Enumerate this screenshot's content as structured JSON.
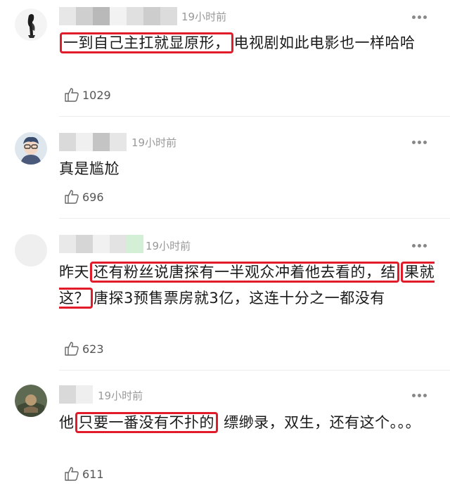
{
  "comments": [
    {
      "time": "19小时前",
      "text_pre": "",
      "highlight1": "一到自己主扛就显原形，",
      "text_mid": "电视剧如此电影也一样哈哈",
      "likes": "1029"
    },
    {
      "time": "19小时前",
      "text": "真是尴尬",
      "likes": "696"
    },
    {
      "time": "19小时前",
      "text_pre": "昨天",
      "highlight1": "还有粉丝说唐探有一半观众冲着他去看的，结",
      "highlight2": "果就这？",
      "text_post": "唐探3预售票房就3亿，这连十分之一都没有",
      "likes": "623"
    },
    {
      "time": "19小时前",
      "text_pre": "他",
      "highlight1": "只要一番没有不扑的",
      "text_post": " 缥缈录，双生，还有这个。。。",
      "likes": "611"
    }
  ],
  "colors": {
    "highlight_border": "#e21b2b",
    "meta_text": "#999999"
  },
  "icons": {
    "like": "thumbs-up-icon",
    "more": "more-dots-icon"
  }
}
